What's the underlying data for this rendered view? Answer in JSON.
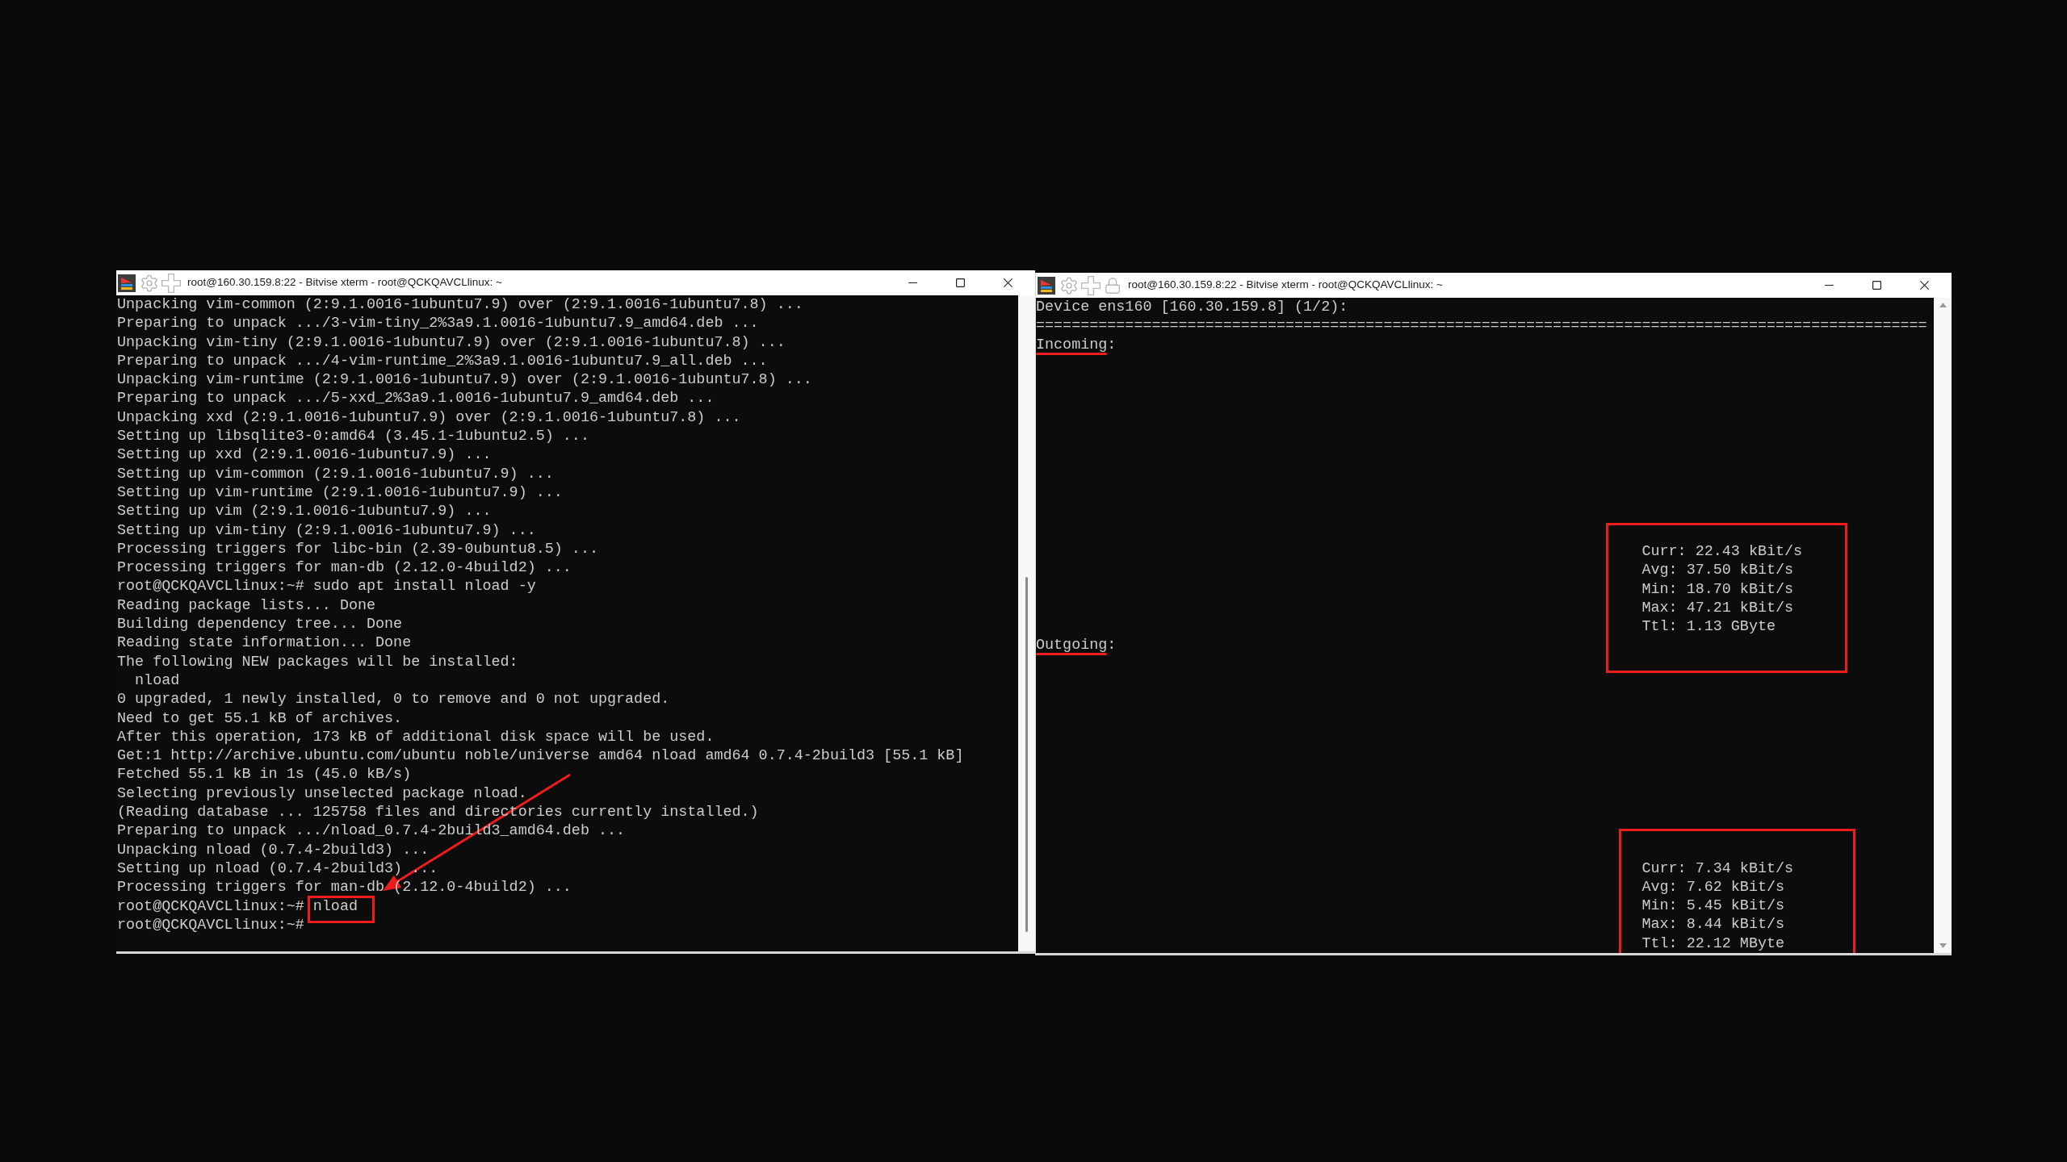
{
  "windows": [
    {
      "kind": "shell",
      "title": "root@160.30.159.8:22 - Bitvise xterm - root@QCKQAVCLlinux: ~",
      "locked": false,
      "lines": [
        {
          "kind": "output",
          "text": "Unpacking vim-common (2:9.1.0016-1ubuntu7.9) over (2:9.1.0016-1ubuntu7.8) ..."
        },
        {
          "kind": "output",
          "text": "Preparing to unpack .../3-vim-tiny_2%3a9.1.0016-1ubuntu7.9_amd64.deb ..."
        },
        {
          "kind": "output",
          "text": "Unpacking vim-tiny (2:9.1.0016-1ubuntu7.9) over (2:9.1.0016-1ubuntu7.8) ..."
        },
        {
          "kind": "output",
          "text": "Preparing to unpack .../4-vim-runtime_2%3a9.1.0016-1ubuntu7.9_all.deb ..."
        },
        {
          "kind": "output",
          "text": "Unpacking vim-runtime (2:9.1.0016-1ubuntu7.9) over (2:9.1.0016-1ubuntu7.8) ..."
        },
        {
          "kind": "output",
          "text": "Preparing to unpack .../5-xxd_2%3a9.1.0016-1ubuntu7.9_amd64.deb ..."
        },
        {
          "kind": "output",
          "text": "Unpacking xxd (2:9.1.0016-1ubuntu7.9) over (2:9.1.0016-1ubuntu7.8) ..."
        },
        {
          "kind": "output",
          "text": "Setting up libsqlite3-0:amd64 (3.45.1-1ubuntu2.5) ..."
        },
        {
          "kind": "output",
          "text": "Setting up xxd (2:9.1.0016-1ubuntu7.9) ..."
        },
        {
          "kind": "output",
          "text": "Setting up vim-common (2:9.1.0016-1ubuntu7.9) ..."
        },
        {
          "kind": "output",
          "text": "Setting up vim-runtime (2:9.1.0016-1ubuntu7.9) ..."
        },
        {
          "kind": "output",
          "text": "Setting up vim (2:9.1.0016-1ubuntu7.9) ..."
        },
        {
          "kind": "output",
          "text": "Setting up vim-tiny (2:9.1.0016-1ubuntu7.9) ..."
        },
        {
          "kind": "output",
          "text": "Processing triggers for libc-bin (2.39-0ubuntu8.5) ..."
        },
        {
          "kind": "output",
          "text": "Processing triggers for man-db (2.12.0-4build2) ..."
        },
        {
          "kind": "prompt",
          "prompt": "root@QCKQAVCLlinux:~#",
          "command": "sudo apt install nload -y",
          "boxed": false
        },
        {
          "kind": "output",
          "text": "Reading package lists... Done"
        },
        {
          "kind": "output",
          "text": "Building dependency tree... Done"
        },
        {
          "kind": "output",
          "text": "Reading state information... Done"
        },
        {
          "kind": "output",
          "text": "The following NEW packages will be installed:"
        },
        {
          "kind": "output",
          "text": "  nload"
        },
        {
          "kind": "output",
          "text": "0 upgraded, 1 newly installed, 0 to remove and 0 not upgraded."
        },
        {
          "kind": "output",
          "text": "Need to get 55.1 kB of archives."
        },
        {
          "kind": "output",
          "text": "After this operation, 173 kB of additional disk space will be used."
        },
        {
          "kind": "output",
          "text": "Get:1 http://archive.ubuntu.com/ubuntu noble/universe amd64 nload amd64 0.7.4-2build3 [55.1 kB]"
        },
        {
          "kind": "output",
          "text": "Fetched 55.1 kB in 1s (45.0 kB/s)"
        },
        {
          "kind": "output",
          "text": "Selecting previously unselected package nload."
        },
        {
          "kind": "output",
          "text": "(Reading database ... 125758 files and directories currently installed.)"
        },
        {
          "kind": "output",
          "text": "Preparing to unpack .../nload_0.7.4-2build3_amd64.deb ..."
        },
        {
          "kind": "output",
          "text": "Unpacking nload (0.7.4-2build3) ..."
        },
        {
          "kind": "output",
          "text": "Setting up nload (0.7.4-2build3) ..."
        },
        {
          "kind": "output",
          "text": "Processing triggers for man-db (2.12.0-4build2) ..."
        },
        {
          "kind": "prompt",
          "prompt": "root@QCKQAVCLlinux:~#",
          "command": "nload",
          "boxed": true
        },
        {
          "kind": "prompt",
          "prompt": "root@QCKQAVCLlinux:~#",
          "boxed": false
        }
      ]
    },
    {
      "kind": "nload",
      "title": "root@160.30.159.8:22 - Bitvise xterm - root@QCKQAVCLlinux: ~",
      "locked": true,
      "header": "Device ens160 [160.30.159.8] (1/2):",
      "separator": "====================================================================================================",
      "sections": [
        {
          "label": "Incoming:",
          "underlined": true,
          "boxed": true,
          "stats": [
            "Curr: 22.43 kBit/s",
            "Avg: 37.50 kBit/s",
            "Min: 18.70 kBit/s",
            "Max: 47.21 kBit/s",
            "Ttl: 1.13 GByte"
          ]
        },
        {
          "label": "Outgoing:",
          "underlined": true,
          "boxed": true,
          "stats": [
            "Curr: 7.34 kBit/s",
            "Avg: 7.62 kBit/s",
            "Min: 5.45 kBit/s",
            "Max: 8.44 kBit/s",
            "Ttl: 22.12 MByte"
          ]
        }
      ]
    }
  ]
}
